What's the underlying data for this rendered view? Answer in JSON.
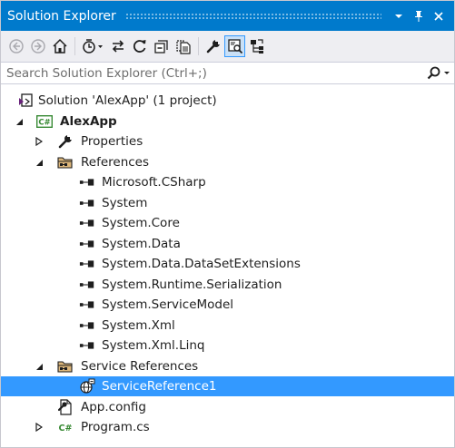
{
  "window": {
    "title": "Solution Explorer",
    "buttons": [
      "dropdown",
      "pin",
      "close"
    ]
  },
  "toolbar": {
    "buttons": [
      "back-icon",
      "forward-icon",
      "home-icon",
      "pending-changes-filter-icon",
      "sync-icon",
      "refresh-icon",
      "collapse-all-icon",
      "show-all-files-icon",
      "properties-icon",
      "preview-selected-items-icon",
      "class-view-icon"
    ],
    "active": "preview-selected-items-icon"
  },
  "search": {
    "placeholder": "Search Solution Explorer (Ctrl+;)"
  },
  "tree": {
    "solution": "Solution 'AlexApp' (1 project)",
    "project": "AlexApp",
    "properties": "Properties",
    "references": "References",
    "reference_items": [
      "Microsoft.CSharp",
      "System",
      "System.Core",
      "System.Data",
      "System.Data.DataSetExtensions",
      "System.Runtime.Serialization",
      "System.ServiceModel",
      "System.Xml",
      "System.Xml.Linq"
    ],
    "service_references": "Service References",
    "service_reference_item": "ServiceReference1",
    "app_config": "App.config",
    "program_cs": "Program.cs",
    "csharp_badge": "C#"
  },
  "colors": {
    "accent": "#007acc",
    "selection": "#3399ff",
    "toolbar_bg": "#eeeef2"
  }
}
